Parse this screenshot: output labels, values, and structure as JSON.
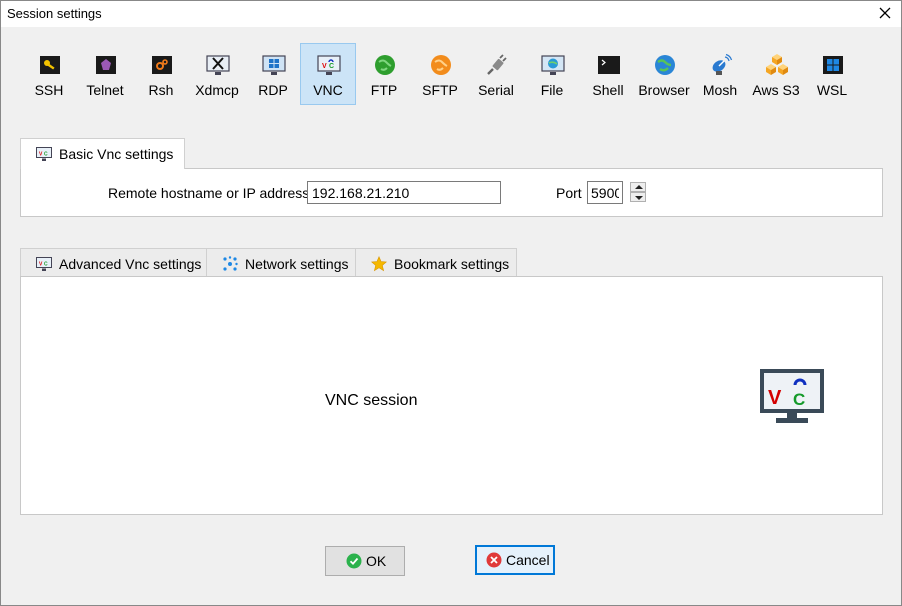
{
  "window": {
    "title": "Session settings"
  },
  "session_types": [
    {
      "label": "SSH",
      "icon": "key-icon"
    },
    {
      "label": "Telnet",
      "icon": "telnet-icon"
    },
    {
      "label": "Rsh",
      "icon": "rsh-icon"
    },
    {
      "label": "Xdmcp",
      "icon": "xdmcp-icon"
    },
    {
      "label": "RDP",
      "icon": "rdp-icon"
    },
    {
      "label": "VNC",
      "icon": "vnc-icon",
      "selected": true
    },
    {
      "label": "FTP",
      "icon": "ftp-globe-icon"
    },
    {
      "label": "SFTP",
      "icon": "sftp-globe-icon"
    },
    {
      "label": "Serial",
      "icon": "serial-plug-icon"
    },
    {
      "label": "File",
      "icon": "file-monitor-icon"
    },
    {
      "label": "Shell",
      "icon": "shell-terminal-icon"
    },
    {
      "label": "Browser",
      "icon": "browser-globe-icon"
    },
    {
      "label": "Mosh",
      "icon": "mosh-satellite-icon"
    },
    {
      "label": "Aws S3",
      "icon": "aws-s3-cubes-icon"
    },
    {
      "label": "WSL",
      "icon": "wsl-windows-icon"
    }
  ],
  "basic": {
    "tab_label": "Basic Vnc settings",
    "host_label": "Remote hostname or IP address *",
    "host_value": "192.168.21.210",
    "port_label": "Port",
    "port_value": "5900"
  },
  "lower_tabs": [
    {
      "label": "Advanced Vnc settings",
      "icon": "vnc-small-icon"
    },
    {
      "label": "Network settings",
      "icon": "network-icon"
    },
    {
      "label": "Bookmark settings",
      "icon": "star-icon"
    }
  ],
  "description": {
    "text": "VNC session",
    "icon": "vnc-large-icon"
  },
  "buttons": {
    "ok": "OK",
    "cancel": "Cancel"
  },
  "colors": {
    "selected_bg": "#cce4f7",
    "focus_border": "#0078d7",
    "ok_green": "#2bb24c",
    "cancel_red": "#e03a3a"
  }
}
